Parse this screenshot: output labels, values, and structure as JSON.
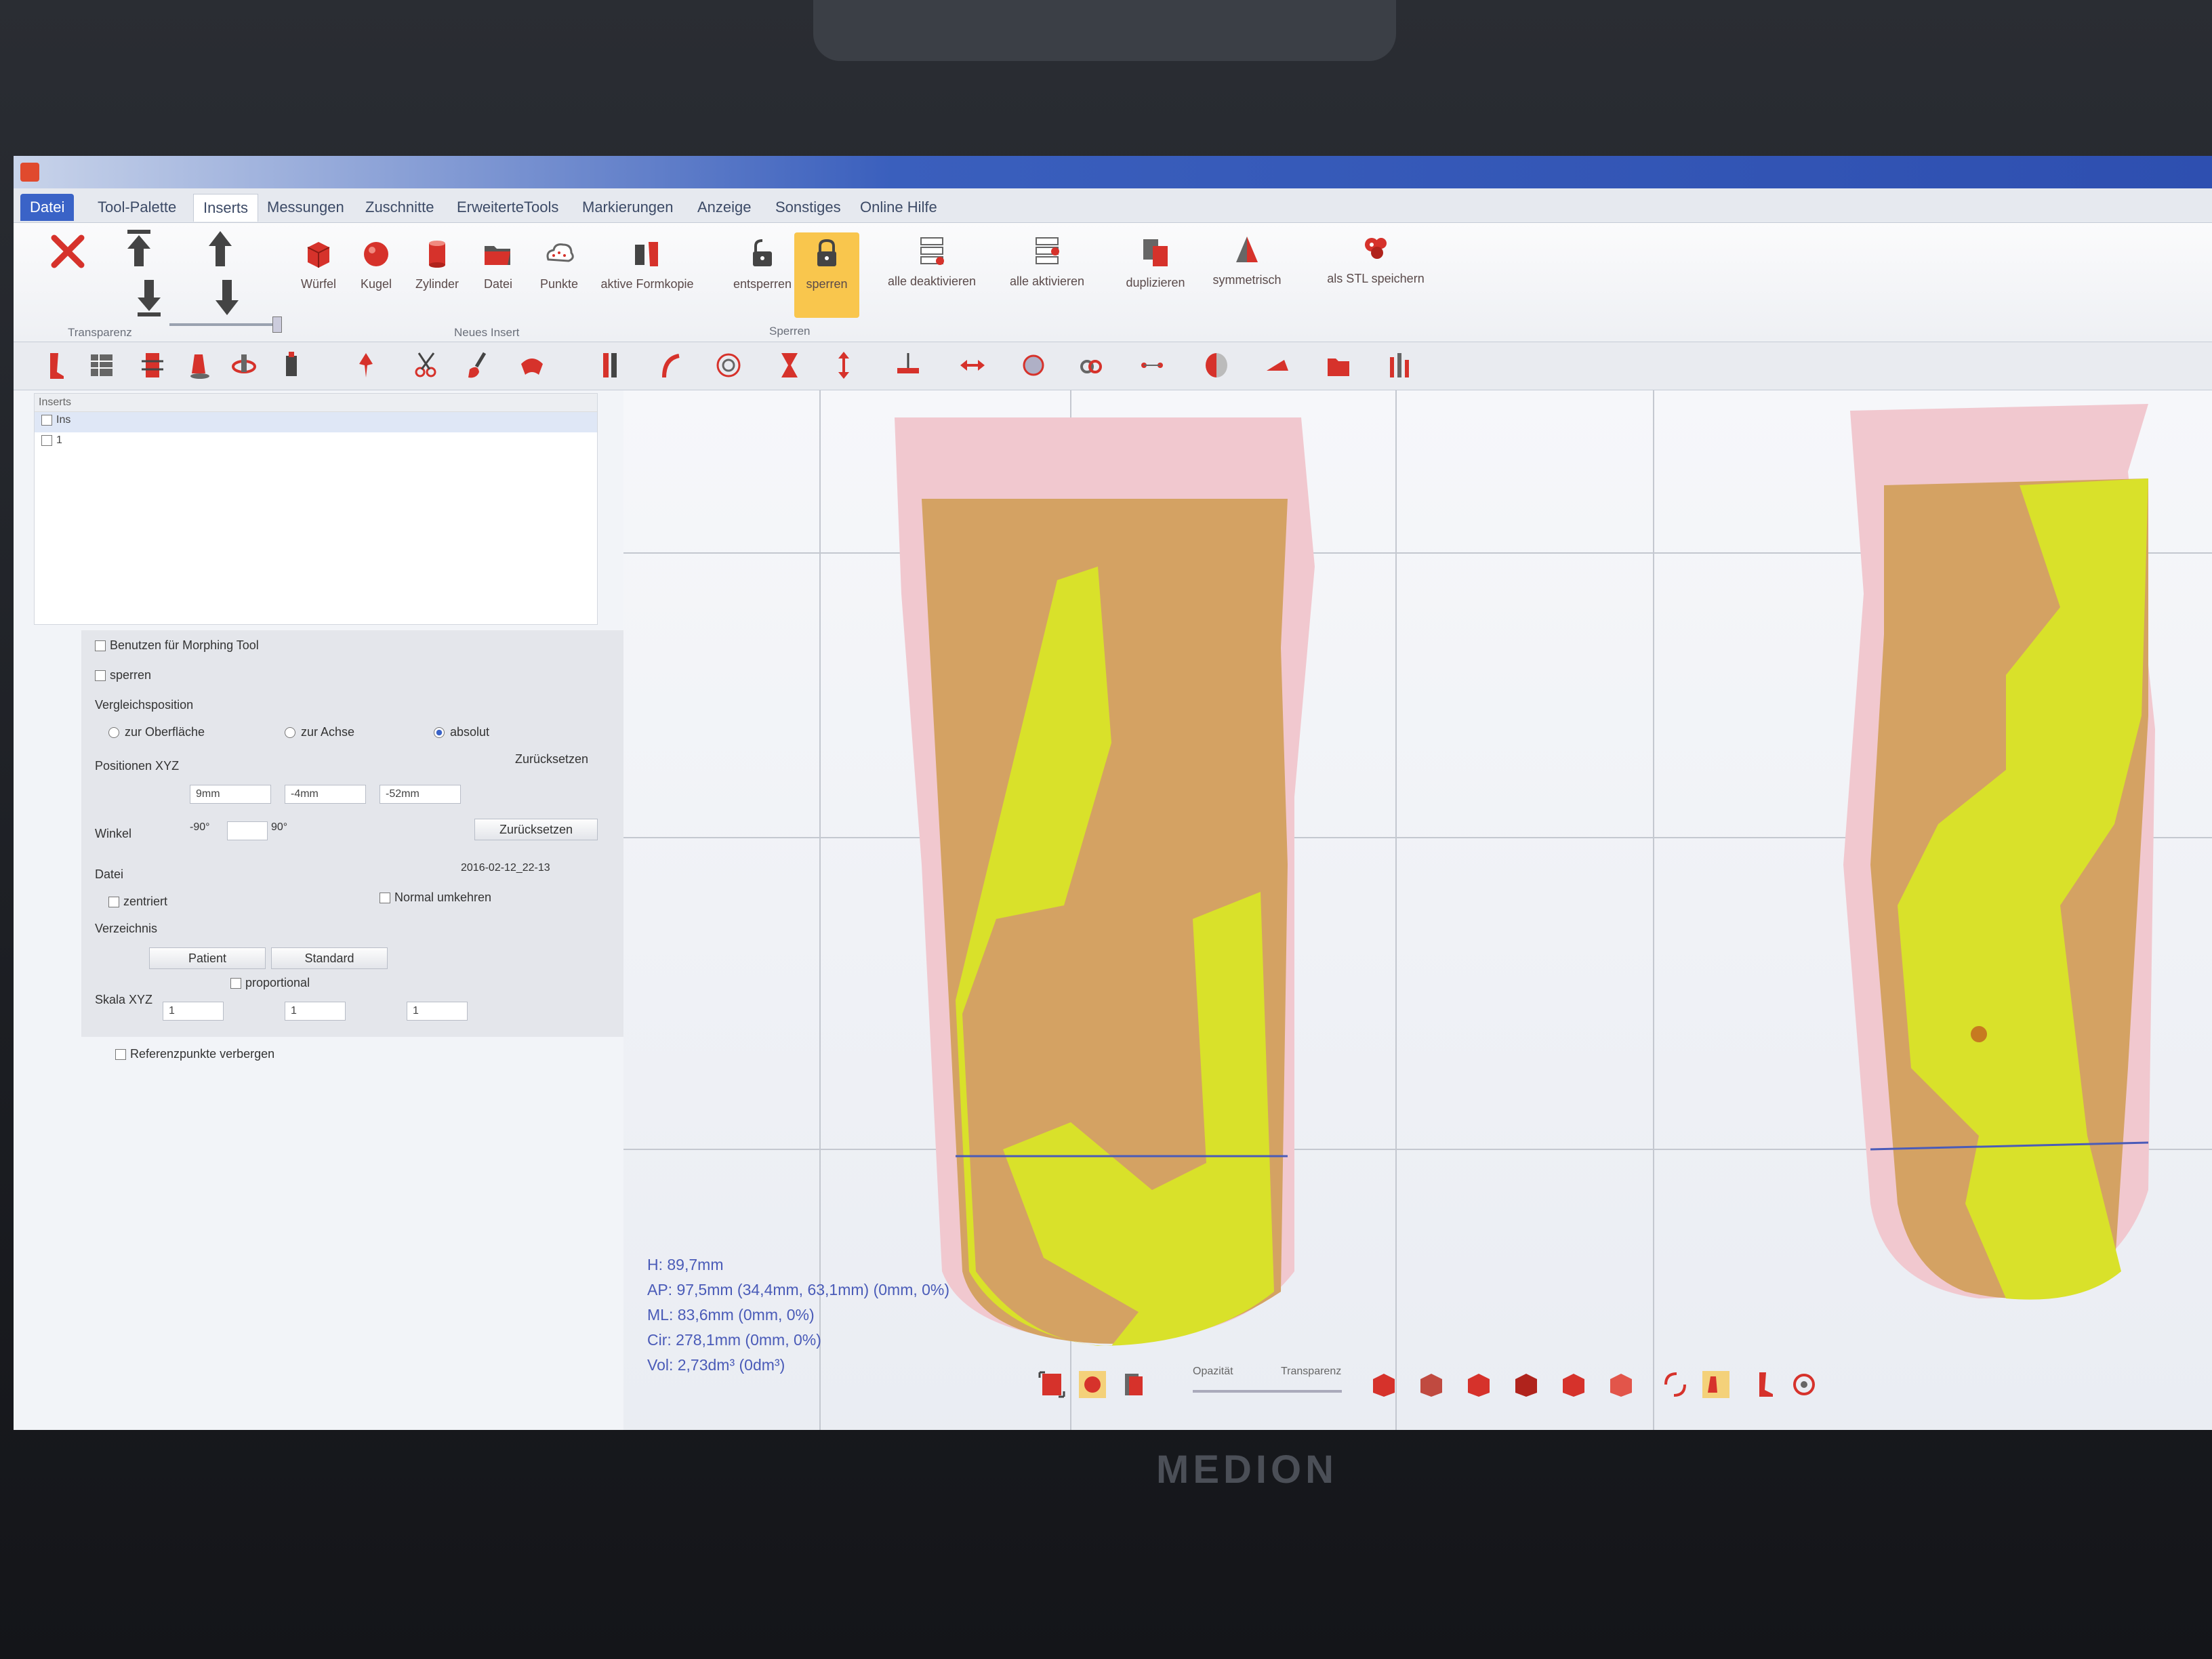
{
  "device": {
    "brand": "MEDION"
  },
  "menu": {
    "tabs": [
      "Datei",
      "Tool-Palette",
      "Inserts",
      "Messungen",
      "Zuschnitte",
      "ErweiterteTools",
      "Markierungen",
      "Anzeige",
      "Sonstiges",
      "Online Hilfe"
    ],
    "active_tab": "Inserts"
  },
  "ribbon": {
    "transparenz_label": "Transparenz",
    "buttons": {
      "wuerfel": "Würfel",
      "kugel": "Kugel",
      "zylinder": "Zylinder",
      "datei": "Datei",
      "punkte": "Punkte",
      "aktive_formkopie": "aktive Formkopie",
      "entsperren": "entsperren",
      "sperren": "sperren",
      "alle_deaktivieren": "alle deaktivieren",
      "alle_aktivieren": "alle aktivieren",
      "duplizieren": "duplizieren",
      "symmetrisch": "symmetrisch",
      "als_stl_speichern": "als STL speichern"
    },
    "group_labels": {
      "neues_insert": "Neues Insert",
      "sperren": "Sperren"
    }
  },
  "tree": {
    "header": "Inserts",
    "items": [
      "Ins",
      "1"
    ]
  },
  "props": {
    "benutzen_morphing": "Benutzen für Morphing Tool",
    "sperren": "sperren",
    "vergleichsposition": "Vergleichsposition",
    "zur_oberflaeche": "zur Oberfläche",
    "zur_achse": "zur Achse",
    "absolut": "absolut",
    "positionen_label": "Positionen XYZ",
    "zuruecksetzen": "Zurücksetzen",
    "pos_x": "9mm",
    "pos_y": "-4mm",
    "pos_z": "-52mm",
    "winkel_label": "Winkel",
    "winkel_min": "-90°",
    "winkel_max": "90°",
    "datei_label": "Datei",
    "datei_value": "2016-02-12_22-13",
    "zentriert": "zentriert",
    "normal_umkehren": "Normal umkehren",
    "verzeichnis": "Verzeichnis",
    "patient": "Patient",
    "standard": "Standard",
    "skala_label": "Skala XYZ",
    "proportional": "proportional",
    "skala_x": "1",
    "skala_y": "1",
    "skala_z": "1",
    "referenzpunkte": "Referenzpunkte verbergen"
  },
  "measurements": {
    "h": "H: 89,7mm",
    "ap": "AP: 97,5mm (34,4mm, 63,1mm) (0mm, 0%)",
    "ml": "ML: 83,6mm (0mm, 0%)",
    "cir": "Cir: 278,1mm (0mm, 0%)",
    "vol": "Vol: 2,73dm³ (0dm³)"
  },
  "bottombar": {
    "opazitaet": "Opazität",
    "transparenz": "Transparenz"
  },
  "colors": {
    "model_pink": "#f1c8cf",
    "model_tan": "#d4a263",
    "model_yellow": "#d9e12a",
    "accent_red": "#d6322b",
    "file_tab_blue": "#3a63c7"
  }
}
